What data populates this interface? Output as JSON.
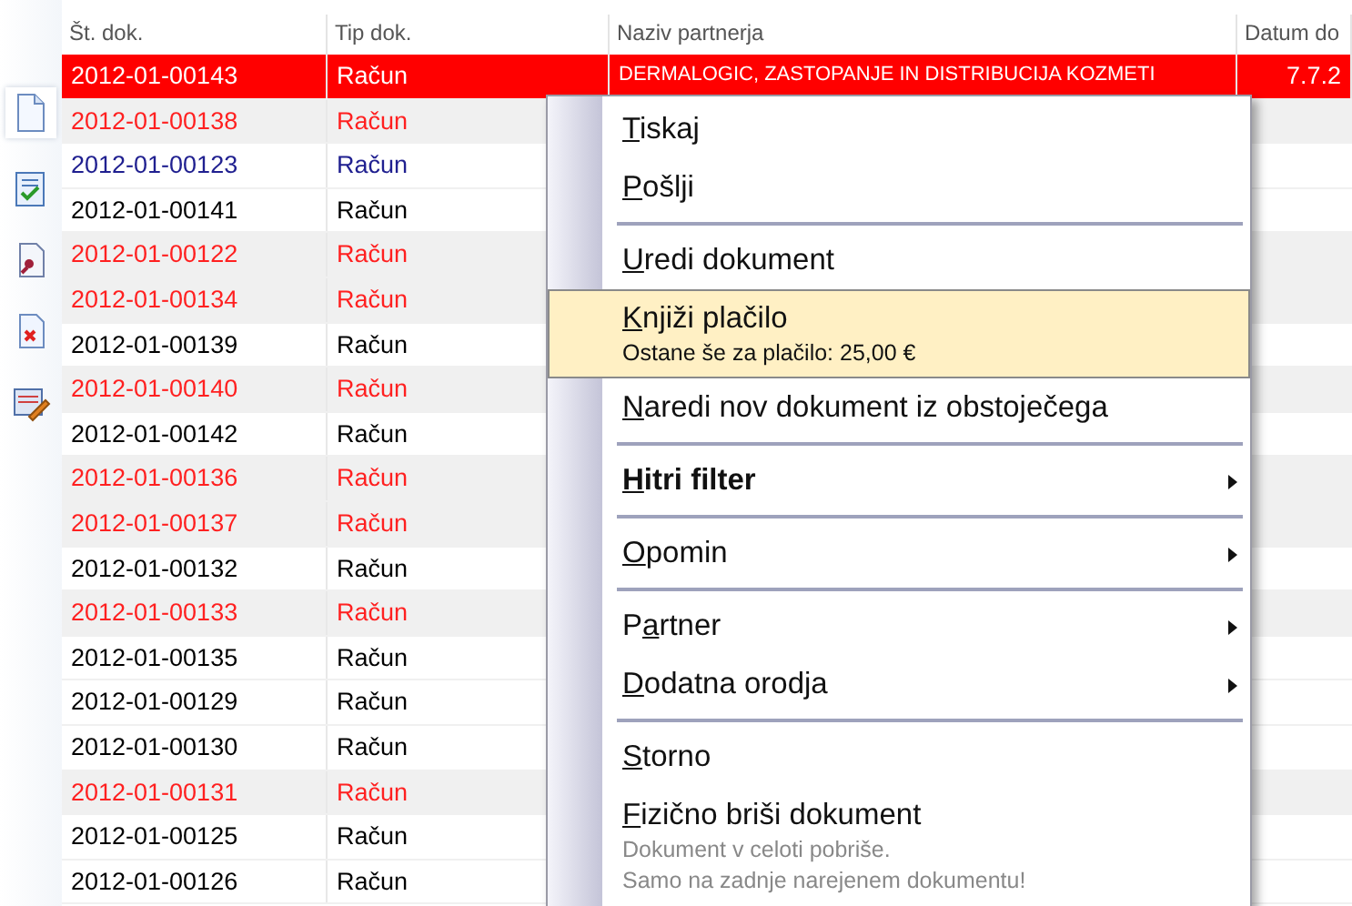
{
  "table": {
    "columns": [
      "Št. dok.",
      "Tip dok.",
      "Naziv partnerja",
      "Datum do"
    ],
    "rows": [
      {
        "number": "2012-01-00143",
        "type": "Račun",
        "partner": "DERMALOGIC, ZASTOPANJE IN DISTRIBUCIJA KOZMETI",
        "date": "7.7.2",
        "shaded": false,
        "selected": true
      },
      {
        "number": "2012-01-00138",
        "type": "Račun",
        "color": "#ff2020",
        "shaded": true,
        "selected": false
      },
      {
        "number": "2012-01-00123",
        "type": "Račun",
        "color": "#202090",
        "shaded": false,
        "selected": false
      },
      {
        "number": "2012-01-00141",
        "type": "Račun",
        "color": "#000000",
        "shaded": false,
        "selected": false
      },
      {
        "number": "2012-01-00122",
        "type": "Račun",
        "color": "#ff2020",
        "shaded": true,
        "selected": false
      },
      {
        "number": "2012-01-00134",
        "type": "Račun",
        "color": "#ff2020",
        "shaded": true,
        "selected": false
      },
      {
        "number": "2012-01-00139",
        "type": "Račun",
        "color": "#000000",
        "shaded": false,
        "selected": false
      },
      {
        "number": "2012-01-00140",
        "type": "Račun",
        "color": "#ff2020",
        "shaded": true,
        "selected": false
      },
      {
        "number": "2012-01-00142",
        "type": "Račun",
        "color": "#000000",
        "shaded": false,
        "selected": false
      },
      {
        "number": "2012-01-00136",
        "type": "Račun",
        "color": "#ff2020",
        "shaded": true,
        "selected": false
      },
      {
        "number": "2012-01-00137",
        "type": "Račun",
        "color": "#ff2020",
        "shaded": true,
        "selected": false
      },
      {
        "number": "2012-01-00132",
        "type": "Račun",
        "color": "#000000",
        "shaded": false,
        "selected": false
      },
      {
        "number": "2012-01-00133",
        "type": "Račun",
        "color": "#ff2020",
        "shaded": true,
        "selected": false
      },
      {
        "number": "2012-01-00135",
        "type": "Račun",
        "color": "#000000",
        "shaded": false,
        "selected": false
      },
      {
        "number": "2012-01-00129",
        "type": "Račun",
        "color": "#000000",
        "shaded": false,
        "selected": false
      },
      {
        "number": "2012-01-00130",
        "type": "Račun",
        "color": "#000000",
        "shaded": false,
        "selected": false
      },
      {
        "number": "2012-01-00131",
        "type": "Račun",
        "color": "#ff2020",
        "shaded": true,
        "selected": false
      },
      {
        "number": "2012-01-00125",
        "type": "Račun",
        "color": "#000000",
        "shaded": false,
        "selected": false
      },
      {
        "number": "2012-01-00126",
        "type": "Račun",
        "color": "#000000",
        "shaded": false,
        "selected": false
      }
    ]
  },
  "context_menu": {
    "items": [
      {
        "kind": "item",
        "label": "Tiskaj",
        "underline_second_letter": false,
        "selected": false,
        "bold": false,
        "submenu": false
      },
      {
        "kind": "item",
        "label": "Pošlji",
        "underline_second_letter": false,
        "selected": false,
        "bold": false,
        "submenu": false
      },
      {
        "kind": "separator"
      },
      {
        "kind": "item",
        "label": "Uredi dokument",
        "underline_second_letter": false,
        "selected": false,
        "bold": false,
        "submenu": false
      },
      {
        "kind": "item",
        "label": "Knjiži plačilo",
        "underline_second_letter": false,
        "selected": true,
        "bold": false,
        "submenu": false,
        "description": [
          "Ostane še za plačilo: 25,00 €"
        ]
      },
      {
        "kind": "item",
        "label": "Naredi nov dokument iz obstoječega",
        "underline_second_letter": false,
        "selected": false,
        "bold": false,
        "submenu": false
      },
      {
        "kind": "separator"
      },
      {
        "kind": "item",
        "label": "Hitri filter",
        "underline_second_letter": false,
        "selected": false,
        "bold": true,
        "submenu": true
      },
      {
        "kind": "separator"
      },
      {
        "kind": "item",
        "label": "Opomin",
        "underline_second_letter": false,
        "selected": false,
        "bold": false,
        "submenu": true
      },
      {
        "kind": "separator"
      },
      {
        "kind": "item",
        "label": "Partner",
        "underline_second_letter": true,
        "selected": false,
        "bold": false,
        "submenu": true
      },
      {
        "kind": "item",
        "label": "Dodatna orodja",
        "underline_second_letter": false,
        "selected": false,
        "bold": false,
        "submenu": true
      },
      {
        "kind": "separator"
      },
      {
        "kind": "item",
        "label": "Storno",
        "underline_second_letter": false,
        "selected": false,
        "bold": false,
        "submenu": false
      },
      {
        "kind": "item",
        "label": "Fizično briši dokument",
        "underline_second_letter": false,
        "selected": false,
        "bold": false,
        "submenu": false,
        "description": [
          "Dokument v celoti pobriše.",
          "Samo na zadnje narejenem dokumentu!"
        ]
      }
    ]
  }
}
